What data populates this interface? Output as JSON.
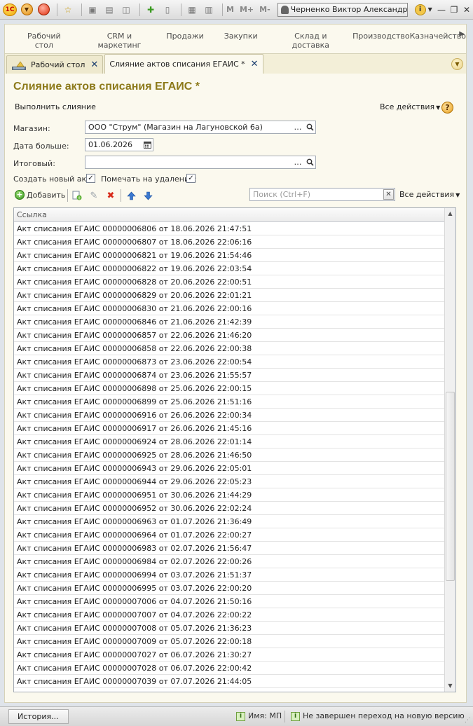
{
  "toolbar": {
    "logo_text": "1С",
    "memory_buttons": [
      "M",
      "M+",
      "M-"
    ],
    "user_name": "Черненко Виктор Александров...",
    "info_glyph": "i"
  },
  "sections": [
    {
      "label": "Рабочий стол"
    },
    {
      "label": "CRM и маркетинг"
    },
    {
      "label": "Продажи"
    },
    {
      "label": "Закупки"
    },
    {
      "label": "Склад и доставка"
    },
    {
      "label": "Производство"
    },
    {
      "label": "Казначейство"
    }
  ],
  "tabs": [
    {
      "label": "Рабочий стол",
      "active": false
    },
    {
      "label": "Слияние актов списания ЕГАИС *",
      "active": true
    }
  ],
  "form": {
    "title": "Слияние актов списания ЕГАИС *",
    "run_label": "Выполнить слияние",
    "all_actions_label": "Все действия",
    "help_glyph": "?",
    "store_label": "Магазин:",
    "store_value": "ООО \"Струм\" (Магазин на Лагуновской 6а)",
    "date_label": "Дата больше:",
    "date_value": "01.06.2026",
    "result_label": "Итоговый:",
    "result_value": "",
    "create_new_label": "Создать новый акт:",
    "create_new_checked": true,
    "mark_delete_label": "Помечать на удаление:",
    "mark_delete_checked": true,
    "add_label": "Добавить",
    "search_placeholder": "Поиск (Ctrl+F)",
    "list_all_actions_label": "Все действия"
  },
  "grid": {
    "column": "Ссылка",
    "rows": [
      "Акт списания ЕГАИС 00000006806 от 18.06.2026 21:47:51",
      "Акт списания ЕГАИС 00000006807 от 18.06.2026 22:06:16",
      "Акт списания ЕГАИС 00000006821 от 19.06.2026 21:54:46",
      "Акт списания ЕГАИС 00000006822 от 19.06.2026 22:03:54",
      "Акт списания ЕГАИС 00000006828 от 20.06.2026 22:00:51",
      "Акт списания ЕГАИС 00000006829 от 20.06.2026 22:01:21",
      "Акт списания ЕГАИС 00000006830 от 21.06.2026 22:00:16",
      "Акт списания ЕГАИС 00000006846 от 21.06.2026 21:42:39",
      "Акт списания ЕГАИС 00000006857 от 22.06.2026 21:46:20",
      "Акт списания ЕГАИС 00000006858 от 22.06.2026 22:00:38",
      "Акт списания ЕГАИС 00000006873 от 23.06.2026 22:00:54",
      "Акт списания ЕГАИС 00000006874 от 23.06.2026 21:55:57",
      "Акт списания ЕГАИС 00000006898 от 25.06.2026 22:00:15",
      "Акт списания ЕГАИС 00000006899 от 25.06.2026 21:51:16",
      "Акт списания ЕГАИС 00000006916 от 26.06.2026 22:00:34",
      "Акт списания ЕГАИС 00000006917 от 26.06.2026 21:45:16",
      "Акт списания ЕГАИС 00000006924 от 28.06.2026 22:01:14",
      "Акт списания ЕГАИС 00000006925 от 28.06.2026 21:46:50",
      "Акт списания ЕГАИС 00000006943 от 29.06.2026 22:05:01",
      "Акт списания ЕГАИС 00000006944 от 29.06.2026 22:05:23",
      "Акт списания ЕГАИС 00000006951 от 30.06.2026 21:44:29",
      "Акт списания ЕГАИС 00000006952 от 30.06.2026 22:02:24",
      "Акт списания ЕГАИС 00000006963 от 01.07.2026 21:36:49",
      "Акт списания ЕГАИС 00000006964 от 01.07.2026 22:00:27",
      "Акт списания ЕГАИС 00000006983 от 02.07.2026 21:56:47",
      "Акт списания ЕГАИС 00000006984 от 02.07.2026 22:00:26",
      "Акт списания ЕГАИС 00000006994 от 03.07.2026 21:51:37",
      "Акт списания ЕГАИС 00000006995 от 03.07.2026 22:00:20",
      "Акт списания ЕГАИС 00000007006 от 04.07.2026 21:50:16",
      "Акт списания ЕГАИС 00000007007 от 04.07.2026 22:00:22",
      "Акт списания ЕГАИС 00000007008 от 05.07.2026 21:36:23",
      "Акт списания ЕГАИС 00000007009 от 05.07.2026 22:00:18",
      "Акт списания ЕГАИС 00000007027 от 06.07.2026 21:30:27",
      "Акт списания ЕГАИС 00000007028 от 06.07.2026 22:00:42",
      "Акт списания ЕГАИС 00000007039 от 07.07.2026 21:44:05"
    ]
  },
  "status": {
    "history_label": "История...",
    "name_text": "Имя: МП",
    "migration_text": "Не завершен переход на новую версию"
  }
}
